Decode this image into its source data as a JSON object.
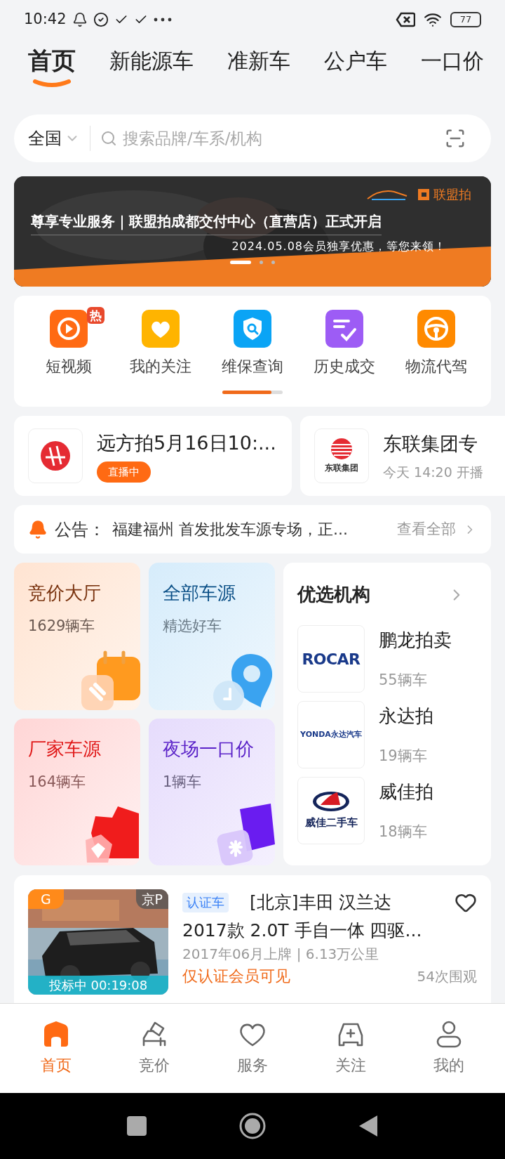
{
  "status_bar": {
    "time": "10:42",
    "battery": "77"
  },
  "tabs": [
    {
      "label": "首页",
      "selected": true
    },
    {
      "label": "新能源车",
      "selected": false
    },
    {
      "label": "准新车",
      "selected": false
    },
    {
      "label": "公户车",
      "selected": false
    },
    {
      "label": "一口价",
      "selected": false
    }
  ],
  "search": {
    "region": "全国",
    "placeholder": "搜索品牌/车系/机构"
  },
  "banner": {
    "brand": "联盟拍",
    "title": "尊享专业服务｜联盟拍成都交付中心（直营店）正式开启",
    "subtitle": "2024.05.08会员独享优惠，等您来领！",
    "pages": [
      {
        "selected": true
      },
      {
        "selected": false
      },
      {
        "selected": false
      }
    ]
  },
  "quick_links": [
    {
      "kind": "video",
      "label": "短视频",
      "badge": "热"
    },
    {
      "kind": "heart",
      "label": "我的关注"
    },
    {
      "kind": "shield",
      "label": "维保查询"
    },
    {
      "kind": "history",
      "label": "历史成交"
    },
    {
      "kind": "wheel",
      "label": "物流代驾"
    }
  ],
  "live_cards": [
    {
      "kind": "red",
      "title": "远方拍5月16日10:...",
      "badge": "直播中"
    },
    {
      "kind": "stripes",
      "logo_text": "东联集团",
      "title": "东联集团专",
      "time": "今天 14:20 开播"
    }
  ],
  "notice": {
    "label": "公告：",
    "text": "福建福州 首发批发车源专场，正...",
    "link": "查看全部"
  },
  "tiles": [
    {
      "kind": "orange",
      "title": "竞价大厅",
      "subtitle": "1629辆车"
    },
    {
      "kind": "blue",
      "title": "全部车源",
      "subtitle": "精选好车"
    },
    {
      "kind": "red",
      "title": "厂家车源",
      "subtitle": "164辆车"
    },
    {
      "kind": "purple",
      "title": "夜场一口价",
      "subtitle": "1辆车"
    }
  ],
  "institutions": {
    "title": "优选机构",
    "items": [
      {
        "kind": "rocar",
        "logo_text": "ROCAR",
        "name": "鹏龙拍卖",
        "count": "55辆车"
      },
      {
        "kind": "yonda",
        "logo_text": "YONDA永达汽车",
        "name": "永达拍",
        "count": "19辆车"
      },
      {
        "kind": "weijia",
        "logo_text": "威佳二手车",
        "name": "威佳拍",
        "count": "18辆车"
      }
    ]
  },
  "car": {
    "corner_tag": "G",
    "plate": "京P",
    "status": "投标中 00:19:08",
    "tag": "认证车",
    "title": "[北京]丰田 汉兰达",
    "subtitle": "2017款 2.0T 手自一体 四驱...",
    "meta": "2017年06月上牌 | 6.13万公里",
    "note": "仅认证会员可见",
    "views": "54次围观",
    "favorited": false
  },
  "bottom_nav": [
    {
      "kind": "home",
      "label": "首页",
      "selected": true
    },
    {
      "kind": "bid",
      "label": "竞价",
      "selected": false
    },
    {
      "kind": "service",
      "label": "服务",
      "selected": false
    },
    {
      "kind": "follow",
      "label": "关注",
      "selected": false
    },
    {
      "kind": "me",
      "label": "我的",
      "selected": false
    }
  ]
}
